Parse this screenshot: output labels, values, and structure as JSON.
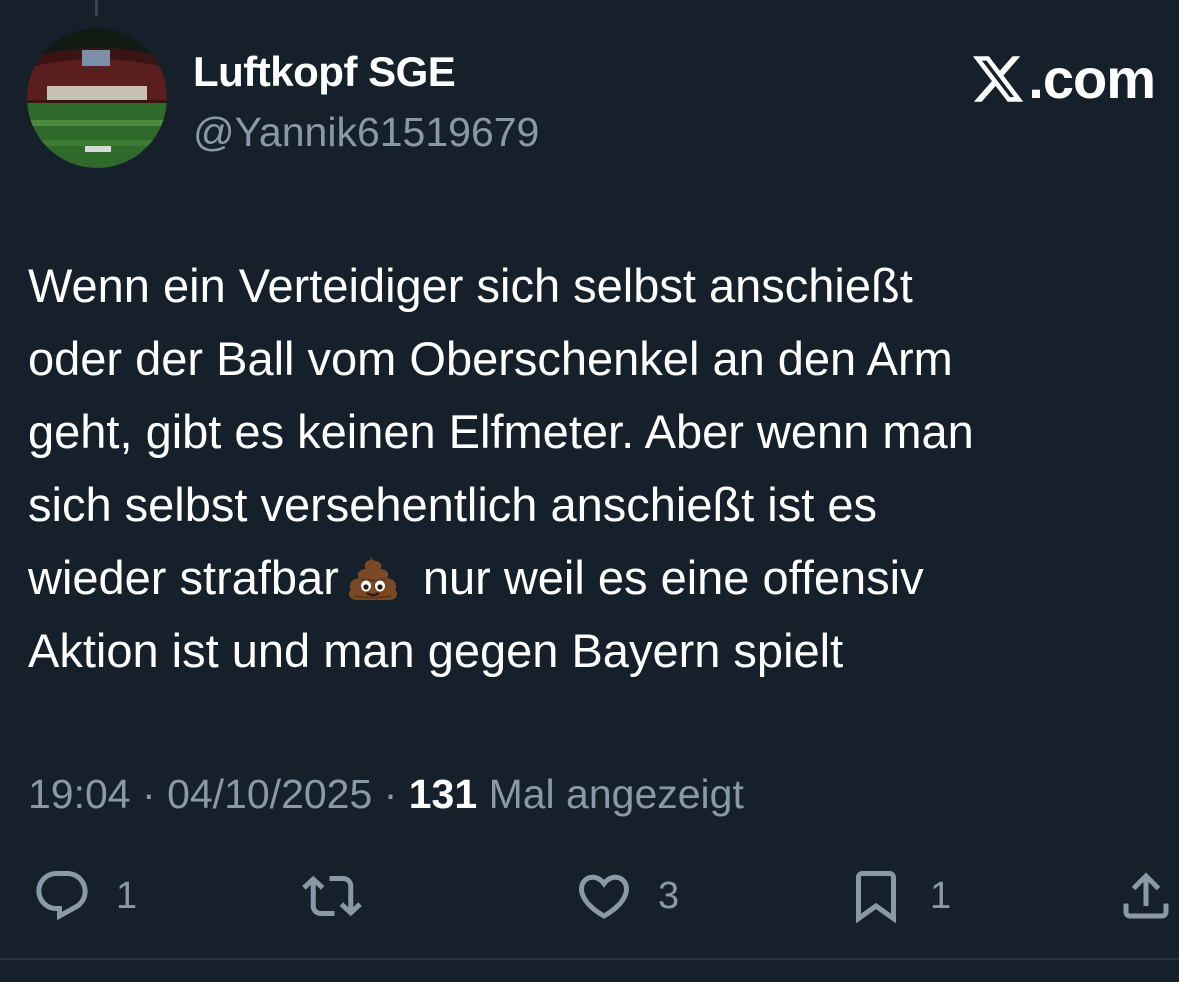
{
  "user": {
    "display_name": "Luftkopf SGE",
    "handle": "@Yannik61519679",
    "avatar": "stadium-avatar"
  },
  "brand": {
    "text": ".com",
    "icon": "x-logo-icon"
  },
  "tweet": {
    "lines": [
      "Wenn ein Verteidiger sich selbst anschießt",
      "oder der Ball vom Oberschenkel an den Arm",
      "geht, gibt es keinen Elfmeter. Aber wenn man",
      "sich selbst versehentlich anschießt ist es",
      "wieder strafbar",
      "nur weil es eine offensiv",
      "Aktion ist und man gegen Bayern spielt"
    ],
    "emoji": "pile-of-poo-emoji"
  },
  "meta": {
    "time": "19:04",
    "separator": "·",
    "date": "04/10/2025",
    "views_count": "131",
    "views_label": "Mal angezeigt"
  },
  "actions": {
    "reply_count": "1",
    "retweet_count": "",
    "like_count": "3",
    "bookmark_count": "1"
  },
  "colors": {
    "background": "#15202b",
    "text_primary": "#ffffff",
    "text_secondary": "#8b98a5"
  }
}
